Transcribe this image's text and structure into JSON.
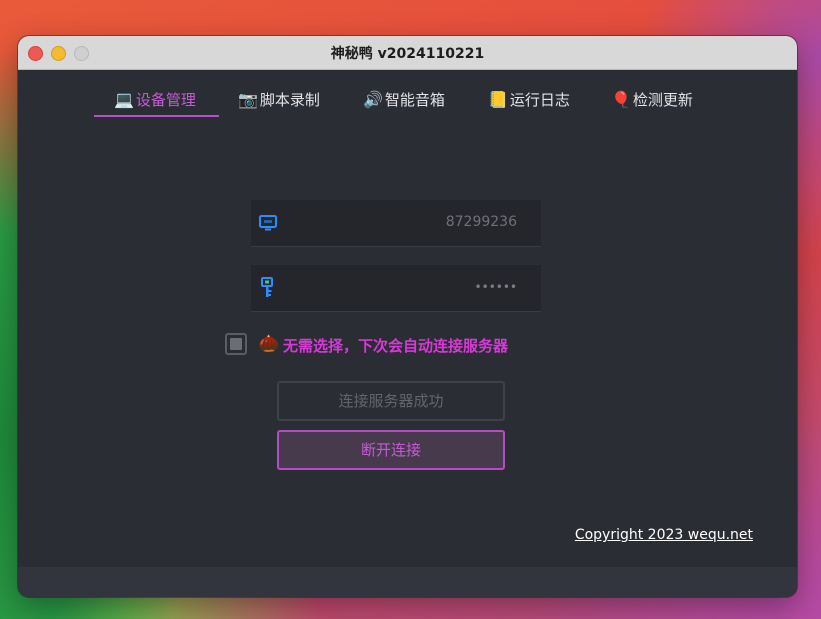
{
  "window": {
    "title": "神秘鸭 v2024110221"
  },
  "tabs": [
    {
      "emoji": "💻",
      "label": "设备管理",
      "active": true
    },
    {
      "emoji": "📷",
      "label": "脚本录制",
      "active": false
    },
    {
      "emoji": "🔊",
      "label": "智能音箱",
      "active": false
    },
    {
      "emoji": "📒",
      "label": "运行日志",
      "active": false
    },
    {
      "emoji": "🎈",
      "label": "检测更新",
      "active": false
    }
  ],
  "form": {
    "device_field": {
      "icon": "monitor-icon",
      "value": "87299236"
    },
    "password_field": {
      "icon": "key-icon",
      "value": "••••••"
    },
    "auto_connect": {
      "emoji": "🌰",
      "label": "无需选择，下次会自动连接服务器",
      "checked": false
    }
  },
  "buttons": {
    "status_label": "连接服务器成功",
    "disconnect_label": "断开连接"
  },
  "footer": {
    "copyright": "Copyright 2023 wequ.net"
  },
  "colors": {
    "accent": "#c55ad6",
    "window_bg": "#2b2d35",
    "input_bg": "#24262b",
    "icon_blue": "#2f8cff"
  }
}
